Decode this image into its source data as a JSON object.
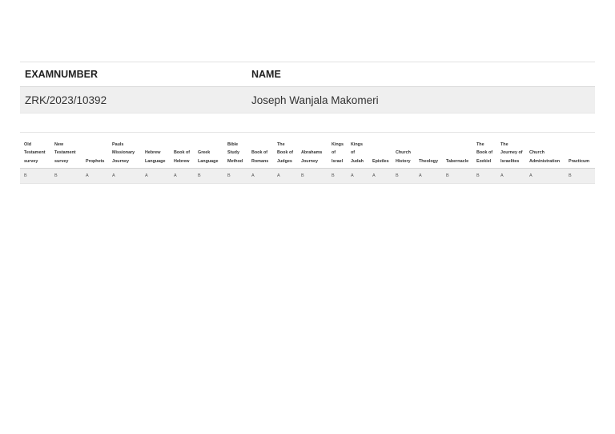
{
  "student_table": {
    "headers": {
      "exam_number": "EXAMNUMBER",
      "name": "NAME"
    },
    "row": {
      "exam_number": "ZRK/2023/10392",
      "name": "Joseph Wanjala Makomeri"
    }
  },
  "grades_table": {
    "columns": [
      "Old Testament survey",
      "New Testament survey",
      "Prophets",
      "Pauls Missionary Journey",
      "Hebrew Language",
      "Book of Hebrew",
      "Greek Language",
      "Bible Study Method",
      "Book of Romans",
      "The Book of Judges",
      "Abrahams Journey",
      "Kings of Israel",
      "Kings of Judah",
      "Epistles",
      "Church History",
      "Theology",
      "Tabernacle",
      "The Book of Ezekiel",
      "The Journey of Israelites",
      "Church Administration",
      "Practicum"
    ],
    "grades": [
      "B",
      "B",
      "A",
      "A",
      "A",
      "A",
      "B",
      "B",
      "A",
      "A",
      "B",
      "B",
      "A",
      "A",
      "B",
      "A",
      "B",
      "B",
      "A",
      "A",
      "B"
    ]
  }
}
